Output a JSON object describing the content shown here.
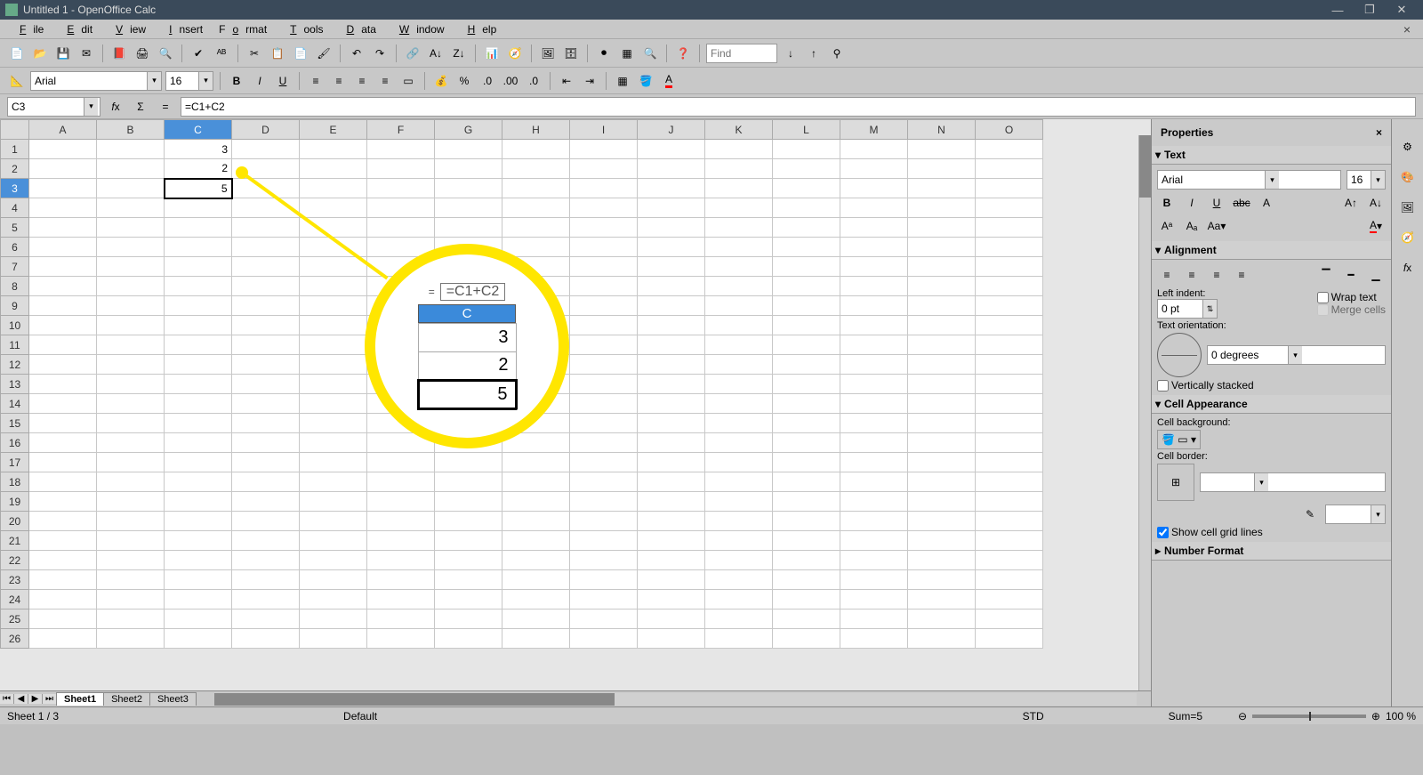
{
  "title": "Untitled 1 - OpenOffice Calc",
  "menus": [
    "File",
    "Edit",
    "View",
    "Insert",
    "Format",
    "Tools",
    "Data",
    "Window",
    "Help"
  ],
  "font": {
    "name": "Arial",
    "size": "16"
  },
  "find_placeholder": "Find",
  "namebox": "C3",
  "formula": "=C1+C2",
  "zoomed": {
    "formula": "=C1+C2",
    "col": "C",
    "v1": "3",
    "v2": "2",
    "v3": "5"
  },
  "columns": [
    "A",
    "B",
    "C",
    "D",
    "E",
    "F",
    "G",
    "H",
    "I",
    "J",
    "K",
    "L",
    "M",
    "N",
    "O"
  ],
  "rows": 26,
  "selected": {
    "row": 3,
    "col": "C"
  },
  "cells": {
    "C1": "3",
    "C2": "2",
    "C3": "5"
  },
  "sheets": [
    "Sheet1",
    "Sheet2",
    "Sheet3"
  ],
  "active_sheet": 0,
  "status": {
    "sheet": "Sheet 1 / 3",
    "style": "Default",
    "mode": "STD",
    "sum": "Sum=5",
    "zoom": "100 %"
  },
  "panel": {
    "title": "Properties",
    "text_section": "Text",
    "font_name": "Arial",
    "font_size": "16",
    "align_section": "Alignment",
    "indent_label": "Left indent:",
    "indent_val": "0 pt",
    "wrap": "Wrap text",
    "merge": "Merge cells",
    "orient_label": "Text orientation:",
    "orient_deg": "0 degrees",
    "vstack": "Vertically stacked",
    "appearance": "Cell Appearance",
    "bg_label": "Cell background:",
    "border_label": "Cell border:",
    "gridlines": "Show cell grid lines",
    "numfmt": "Number Format"
  }
}
